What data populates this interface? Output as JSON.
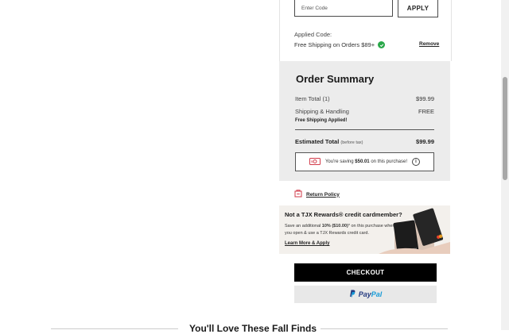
{
  "promo": {
    "placeholder": "Enter Code",
    "apply_label": "APPLY",
    "applied_label": "Applied Code:",
    "applied_code": "Free Shipping on Orders $89+",
    "remove_label": "Remove"
  },
  "summary": {
    "title": "Order Summary",
    "item_total_label": "Item Total (1)",
    "item_total_value": "$99.99",
    "shipping_label": "Shipping & Handling",
    "shipping_value": "FREE",
    "free_shipping_note": "Free Shipping Applied!",
    "estimated_label": "Estimated Total",
    "estimated_note": "(before tax)",
    "estimated_value": "$99.99",
    "saving_prefix": "You're saving",
    "saving_amount": "$50.01",
    "saving_suffix": "on this purchase!"
  },
  "return_policy": {
    "label": "Return Policy"
  },
  "rewards": {
    "title": "Not a TJX Rewards® credit cardmember?",
    "desc_1": "Save an additional",
    "desc_bold": "10% ($10.00)",
    "desc_2": "* on this purchase when you open & use a TJX Rewards credit card.",
    "link": "Learn More & Apply",
    "card_brand": "TJX"
  },
  "checkout": {
    "label": "CHECKOUT"
  },
  "paypal": {
    "pay": "Pay",
    "pal": "Pal"
  },
  "section": {
    "title": "You'll Love These Fall Finds"
  },
  "colors": {
    "checkout_bg": "#000000",
    "summary_bg": "#ececec",
    "check": "#2aa84a",
    "paypal_dark": "#253b80",
    "paypal_light": "#179bd7"
  }
}
